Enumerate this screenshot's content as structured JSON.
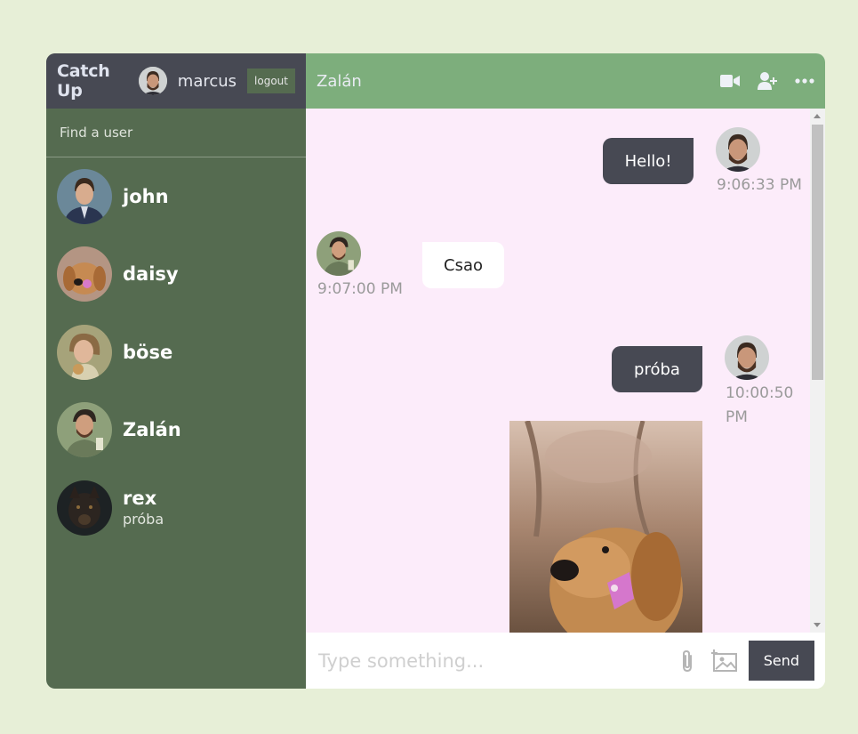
{
  "navbar": {
    "logo": "Catch Up",
    "user_name": "marcus",
    "logout_label": "logout"
  },
  "search": {
    "placeholder": "Find a user"
  },
  "users": [
    {
      "name": "john",
      "last_message": ""
    },
    {
      "name": "daisy",
      "last_message": ""
    },
    {
      "name": "böse",
      "last_message": ""
    },
    {
      "name": "Zalán",
      "last_message": ""
    },
    {
      "name": "rex",
      "last_message": "próba"
    }
  ],
  "chat": {
    "contact_name": "Zalán",
    "icons": [
      "video-camera-icon",
      "add-user-icon",
      "more-icon"
    ],
    "messages": [
      {
        "text": "Hello!",
        "time": "9:06:33 PM",
        "owner": true
      },
      {
        "text": "Csao",
        "time": "9:07:00 PM",
        "owner": false
      },
      {
        "text": "próba",
        "time": "10:00:50 PM",
        "owner": true
      }
    ],
    "time_3_line1": "10:00:50",
    "time_3_line2": "PM"
  },
  "input": {
    "placeholder": "Type something...",
    "send_label": "Send"
  },
  "colors": {
    "page_bg": "#e7efd7",
    "sidebar": "#556b50",
    "navbar": "#474953",
    "chatbar": "#7dae7c",
    "messages_bg": "#fcecfa"
  }
}
